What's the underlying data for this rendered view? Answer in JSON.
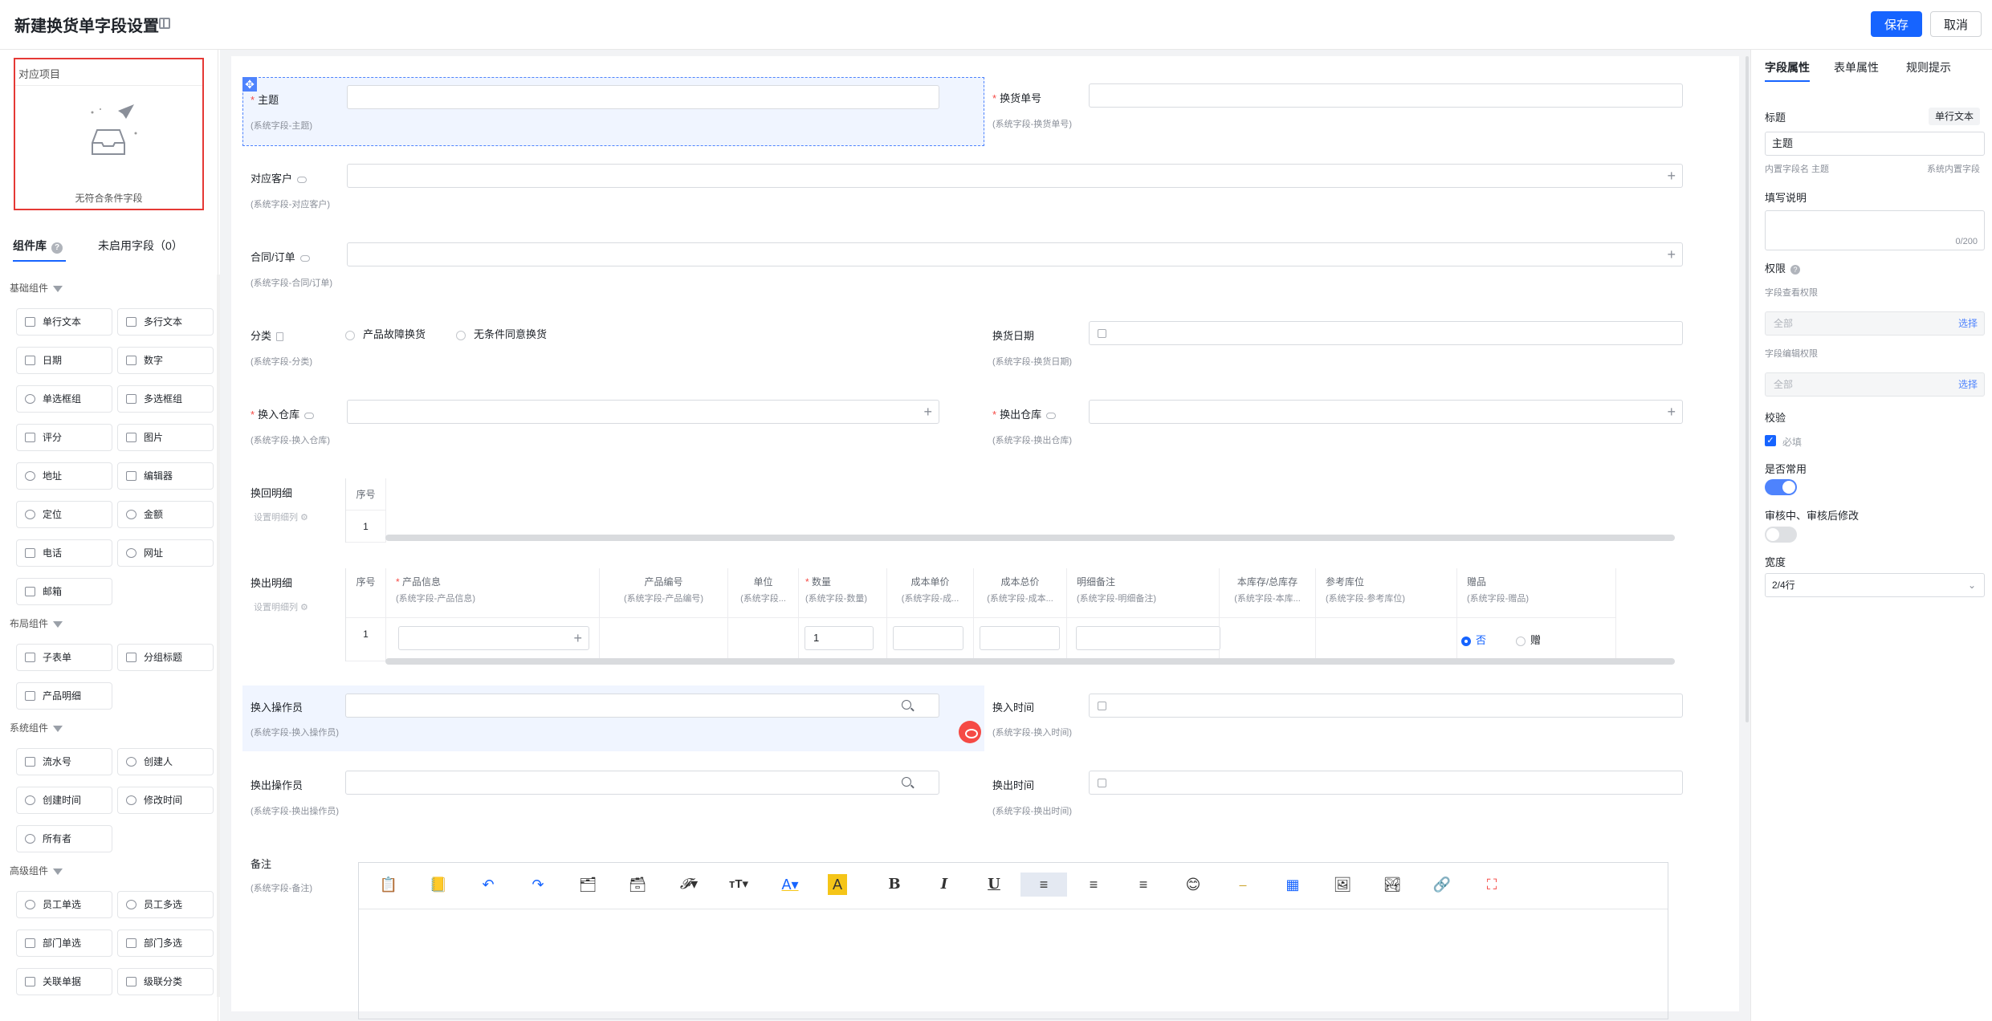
{
  "header": {
    "title": "新建换货单字段设置",
    "save": "保存",
    "cancel": "取消"
  },
  "left": {
    "related_title": "对应项目",
    "empty_text": "无符合条件字段",
    "tabs": [
      "组件库",
      "未启用字段（0）"
    ],
    "groups": {
      "basic": "基础组件",
      "layout": "布局组件",
      "system": "系统组件",
      "advanced": "高级组件"
    },
    "basic": [
      "单行文本",
      "多行文本",
      "日期",
      "数字",
      "单选框组",
      "多选框组",
      "评分",
      "图片",
      "地址",
      "编辑器",
      "定位",
      "金额",
      "电话",
      "网址",
      "邮箱"
    ],
    "layout": [
      "子表单",
      "分组标题",
      "产品明细"
    ],
    "system": [
      "流水号",
      "创建人",
      "创建时间",
      "修改时间",
      "所有者"
    ],
    "advanced": [
      "员工单选",
      "员工多选",
      "部门单选",
      "部门多选",
      "关联单据",
      "级联分类"
    ]
  },
  "form": {
    "subject": {
      "label": "主题",
      "sub": "(系统字段-主题)"
    },
    "exchange_no": {
      "label": "换货单号",
      "sub": "(系统字段-换货单号)"
    },
    "customer": {
      "label": "对应客户",
      "sub": "(系统字段-对应客户)"
    },
    "contract": {
      "label": "合同/订单",
      "sub": "(系统字段-合同/订单)"
    },
    "category": {
      "label": "分类",
      "sub": "(系统字段-分类)",
      "opt1": "产品故障换货",
      "opt2": "无条件同意换货"
    },
    "exchange_date": {
      "label": "换货日期",
      "sub": "(系统字段-换货日期)"
    },
    "in_wh": {
      "label": "换入仓库",
      "sub": "(系统字段-换入仓库)"
    },
    "out_wh": {
      "label": "换出仓库",
      "sub": "(系统字段-换出仓库)"
    },
    "return_detail": {
      "label": "换回明细",
      "sub": "设置明细列",
      "col_no": "序号",
      "row1": "1"
    },
    "out_detail": {
      "label": "换出明细",
      "sub": "设置明细列",
      "cols": [
        {
          "h1": "序号",
          "h2": ""
        },
        {
          "h1": "产品信息",
          "h2": "(系统字段-产品信息)",
          "req": "*"
        },
        {
          "h1": "产品编号",
          "h2": "(系统字段-产品编号)"
        },
        {
          "h1": "单位",
          "h2": "(系统字段..."
        },
        {
          "h1": "数量",
          "h2": "(系统字段-数量)",
          "req": "*"
        },
        {
          "h1": "成本单价",
          "h2": "(系统字段-成..."
        },
        {
          "h1": "成本总价",
          "h2": "(系统字段-成本..."
        },
        {
          "h1": "明细备注",
          "h2": "(系统字段-明细备注)"
        },
        {
          "h1": "本库存/总库存",
          "h2": "(系统字段-本库..."
        },
        {
          "h1": "参考库位",
          "h2": "(系统字段-参考库位)"
        },
        {
          "h1": "赠品",
          "h2": "(系统字段-赠品)"
        }
      ],
      "row1": "1",
      "qty": "1",
      "gift_no": "否",
      "gift_yes": "赠"
    },
    "in_op": {
      "label": "换入操作员",
      "sub": "(系统字段-换入操作员)"
    },
    "in_time": {
      "label": "换入时间",
      "sub": "(系统字段-换入时间)"
    },
    "out_op": {
      "label": "换出操作员",
      "sub": "(系统字段-换出操作员)"
    },
    "out_time": {
      "label": "换出时间",
      "sub": "(系统字段-换出时间)"
    },
    "remark": {
      "label": "备注",
      "sub": "(系统字段-备注)"
    }
  },
  "editor_tools": [
    "paste-text-icon",
    "paste-word-icon",
    "undo-icon",
    "redo-icon",
    "copy-format-icon",
    "clear-format-icon",
    "font-family-icon",
    "font-size-icon",
    "font-color-icon",
    "highlight-icon",
    "bold-icon",
    "italic-icon",
    "underline-icon",
    "align-left-icon",
    "align-center-icon",
    "align-right-icon",
    "emoji-icon",
    "horizontal-rule-icon",
    "table-icon",
    "insert-image-icon",
    "image-icon",
    "link-icon",
    "fullscreen-icon"
  ],
  "right": {
    "tabs": [
      "字段属性",
      "表单属性",
      "规则提示"
    ],
    "title_label": "标题",
    "field_type": "单行文本",
    "title_value": "主题",
    "inner_name": "内置字段名 主题",
    "sys_field": "系统内置字段",
    "desc_label": "填写说明",
    "desc_count": "0/200",
    "perm_label": "权限",
    "view_perm": "字段查看权限",
    "view_val": "全部",
    "edit_perm": "字段编辑权限",
    "edit_val": "全部",
    "pick": "选择",
    "verify": "校验",
    "required": "必填",
    "common": "是否常用",
    "audit": "审核中、审核后修改",
    "width_label": "宽度",
    "width_val": "2/4行"
  },
  "colors": {
    "primary": "#1664ff",
    "danger": "#f54a45",
    "selected_bg": "#f0f5ff"
  }
}
